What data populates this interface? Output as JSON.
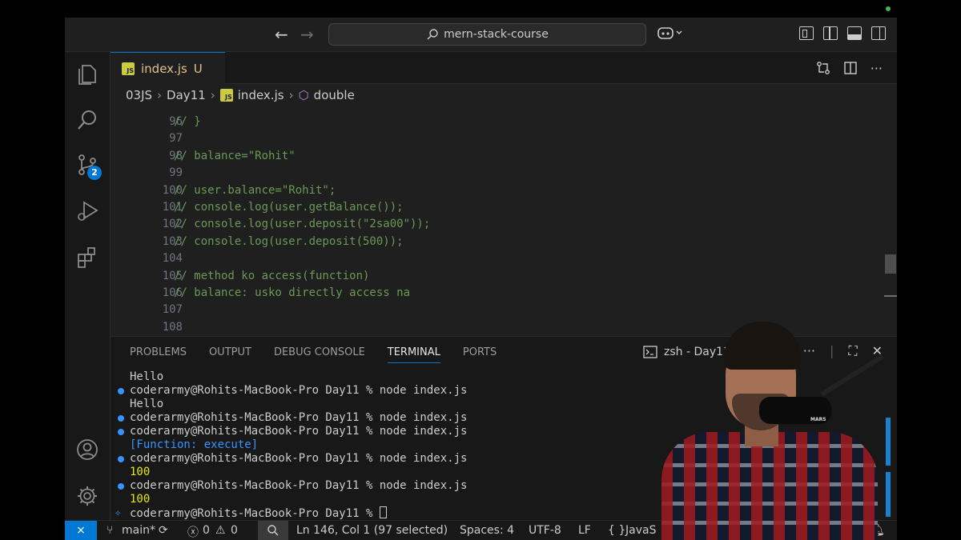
{
  "titlebar": {
    "search_text": "mern-stack-course"
  },
  "activity": {
    "scm_badge": "2"
  },
  "tab": {
    "js_icon": "JS",
    "filename": "index.js",
    "status": "U"
  },
  "breadcrumb": {
    "items": [
      "03JS",
      "Day11",
      "index.js",
      "double"
    ],
    "js_icon": "JS"
  },
  "editor": {
    "lines": [
      {
        "n": "96",
        "code": "// }"
      },
      {
        "n": "97",
        "code": ""
      },
      {
        "n": "98",
        "code": "// balance=\"Rohit\""
      },
      {
        "n": "99",
        "code": ""
      },
      {
        "n": "100",
        "code": "// user.balance=\"Rohit\";"
      },
      {
        "n": "101",
        "code": "// console.log(user.getBalance());"
      },
      {
        "n": "102",
        "code": "// console.log(user.deposit(\"2sa00\"));"
      },
      {
        "n": "103",
        "code": "// console.log(user.deposit(500));"
      },
      {
        "n": "104",
        "code": ""
      },
      {
        "n": "105",
        "code": "// method ko access(function)"
      },
      {
        "n": "106",
        "code": "// balance: usko directly access na"
      },
      {
        "n": "107",
        "code": ""
      },
      {
        "n": "108",
        "code": ""
      }
    ]
  },
  "panel": {
    "tabs": [
      "PROBLEMS",
      "OUTPUT",
      "DEBUG CONSOLE",
      "TERMINAL",
      "PORTS"
    ],
    "terminal_name": "zsh - Day11",
    "terminal_lines": [
      {
        "text": "Hello",
        "dot": false,
        "style": "plain"
      },
      {
        "text": "coderarmy@Rohits-MacBook-Pro Day11 % node index.js",
        "dot": true,
        "style": "plain"
      },
      {
        "text": "Hello",
        "dot": false,
        "style": "plain"
      },
      {
        "text": "coderarmy@Rohits-MacBook-Pro Day11 % node index.js",
        "dot": true,
        "style": "plain"
      },
      {
        "text": "coderarmy@Rohits-MacBook-Pro Day11 % node index.js",
        "dot": true,
        "style": "plain"
      },
      {
        "text": "[Function: execute]",
        "dot": false,
        "style": "fn"
      },
      {
        "text": "coderarmy@Rohits-MacBook-Pro Day11 % node index.js",
        "dot": true,
        "style": "plain"
      },
      {
        "text": "100",
        "dot": false,
        "style": "num"
      },
      {
        "text": "coderarmy@Rohits-MacBook-Pro Day11 % node index.js",
        "dot": true,
        "style": "plain"
      },
      {
        "text": "100",
        "dot": false,
        "style": "num"
      },
      {
        "text": "coderarmy@Rohits-MacBook-Pro Day11 % ",
        "dot": false,
        "style": "prompt"
      }
    ]
  },
  "statusbar": {
    "branch": "main*",
    "errors": "0",
    "warnings": "0",
    "position": "Ln 146, Col 1 (97 selected)",
    "spaces": "Spaces: 4",
    "encoding": "UTF-8",
    "eol": "LF",
    "braces": "{ }",
    "language": "JavaS"
  },
  "webcam": {
    "mic_label": "MARS"
  },
  "colors": {
    "accent": "#0078d4",
    "comment": "#6a9955",
    "modified": "#e2c08d"
  }
}
